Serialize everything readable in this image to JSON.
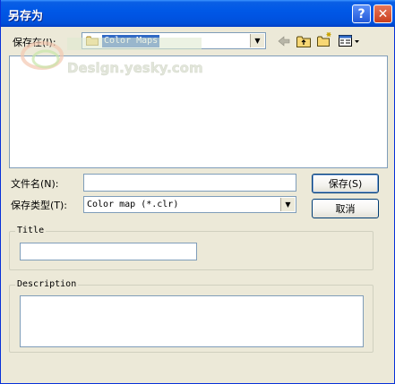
{
  "window": {
    "title": "另存为"
  },
  "titlebar": {
    "help_glyph": "?",
    "close_glyph": "✕"
  },
  "save_in": {
    "label": "保存在(I):",
    "value": "Color Maps"
  },
  "toolbar": {
    "icons": [
      "back-arrow-icon",
      "up-folder-icon",
      "new-folder-icon",
      "view-menu-icon"
    ]
  },
  "watermark": {
    "text": "Design.yesky.com"
  },
  "file_name": {
    "label": "文件名(N):",
    "value": ""
  },
  "file_type": {
    "label": "保存类型(T):",
    "value": "Color map (*.clr)"
  },
  "buttons": {
    "save": "保存(S)",
    "cancel": "取消"
  },
  "title_group": {
    "label": "Title",
    "value": ""
  },
  "description_group": {
    "label": "Description",
    "value": ""
  },
  "colors": {
    "selection": "#316ac5",
    "titlebar": "#0054e3"
  }
}
